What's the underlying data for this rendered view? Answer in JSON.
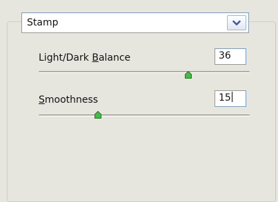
{
  "filter": {
    "mode_dropdown": {
      "selected": "Stamp",
      "icon": "chevron-down-icon"
    }
  },
  "light_dark_balance": {
    "label_prefix": "Light/Dark ",
    "label_mnemonic": "B",
    "label_rest": "alance",
    "value": "36"
  },
  "smoothness": {
    "label_mnemonic": "S",
    "label_rest": "moothness",
    "value": "15"
  },
  "colors": {
    "slider_thumb_fill": "#3fbf3f",
    "input_border": "#7f9db9"
  }
}
